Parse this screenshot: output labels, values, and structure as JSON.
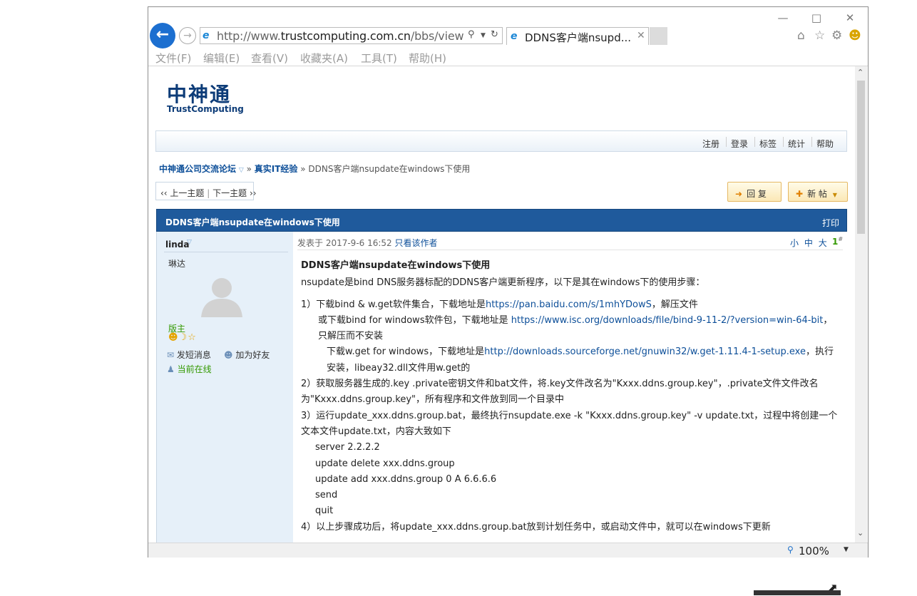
{
  "browser": {
    "address": "http://www.trustcomputing.com.cn/bbs/view",
    "address_host": "trustcomputing.com.cn",
    "tab_title": "DDNS客户端nsupd...",
    "zoom": "100%",
    "menu": [
      "文件(F)",
      "编辑(E)",
      "查看(V)",
      "收藏夹(A)",
      "工具(T)",
      "帮助(H)"
    ]
  },
  "site": {
    "logo_cn": "中神通",
    "logo_en": "TrustComputing",
    "topnav": [
      "注册",
      "登录",
      "标签",
      "统计",
      "帮助"
    ]
  },
  "breadcrumb": {
    "forum": "中神通公司交流论坛",
    "board": "真实IT经验",
    "sep": "»",
    "current": "DDNS客户端nsupdate在windows下使用"
  },
  "threadnav": {
    "prev": "‹‹ 上一主题",
    "divider": "|",
    "next": "下一主题 ››"
  },
  "buttons": {
    "reply": "回 复",
    "new_post": "新 帖"
  },
  "post": {
    "header_title": "DDNS客户端nsupdate在windows下使用",
    "print": "打印",
    "meta_prefix": "发表于 2017-9-6 16:52",
    "only_author": "只看该作者",
    "font_small": "小",
    "font_mid": "中",
    "font_large": "大",
    "floor": "1",
    "floor_suffix": "#"
  },
  "author": {
    "name": "linda",
    "realname": "琳达",
    "rank": "版主",
    "send_msg": "发短消息",
    "add_friend": "加为好友",
    "online": "当前在线"
  },
  "content": {
    "title": "DDNS客户端nsupdate在windows下使用",
    "intro": "nsupdate是bind DNS服务器标配的DDNS客户端更新程序，以下是其在windows下的使用步骤：",
    "s1a_pre": "1）下载bind & w.get软件集合，下载地址是",
    "s1a_link": "https://pan.baidu.com/s/1mhYDowS",
    "s1a_post": "，解压文件",
    "s1b_pre": "或下载bind for windows软件包，下载地址是 ",
    "s1b_link": "https://www.isc.org/downloads/file/bind-9-11-2/?version=win-64-bit",
    "s1b_post": "，只解压而不安装",
    "s1c_pre": "下载w.get for windows，下载地址是",
    "s1c_link": "http://downloads.sourceforge.net/gnuwin32/w.get-1.11.4-1-setup.exe",
    "s1c_post": "，执行安装，libeay32.dll文件用w.get的",
    "s2": "2）获取服务器生成的.key .private密钥文件和bat文件，将.key文件改名为\"Kxxx.ddns.group.key\"，.private文件文件改名为\"Kxxx.ddns.group.key\"，所有程序和文件放到同一个目录中",
    "s3": "3）运行update_xxx.ddns.group.bat，最终执行nsupdate.exe -k \"Kxxx.ddns.group.key\" -v update.txt，过程中将创建一个文本文件update.txt，内容大致如下",
    "code1": "server 2.2.2.2",
    "code2": "update delete xxx.ddns.group",
    "code3": "update add xxx.ddns.group 0 A 6.6.6.6",
    "code4": "send",
    "code5": "quit",
    "s4": "4）以上步骤成功后，将update_xxx.ddns.group.bat放到计划任务中，或启动文件中，就可以在windows下更新"
  },
  "colors": {
    "post_header_bg": "#1f5a9c",
    "link": "#0d4f99",
    "author_bg": "#e6f0f9",
    "back_button": "#1c6fd0"
  }
}
